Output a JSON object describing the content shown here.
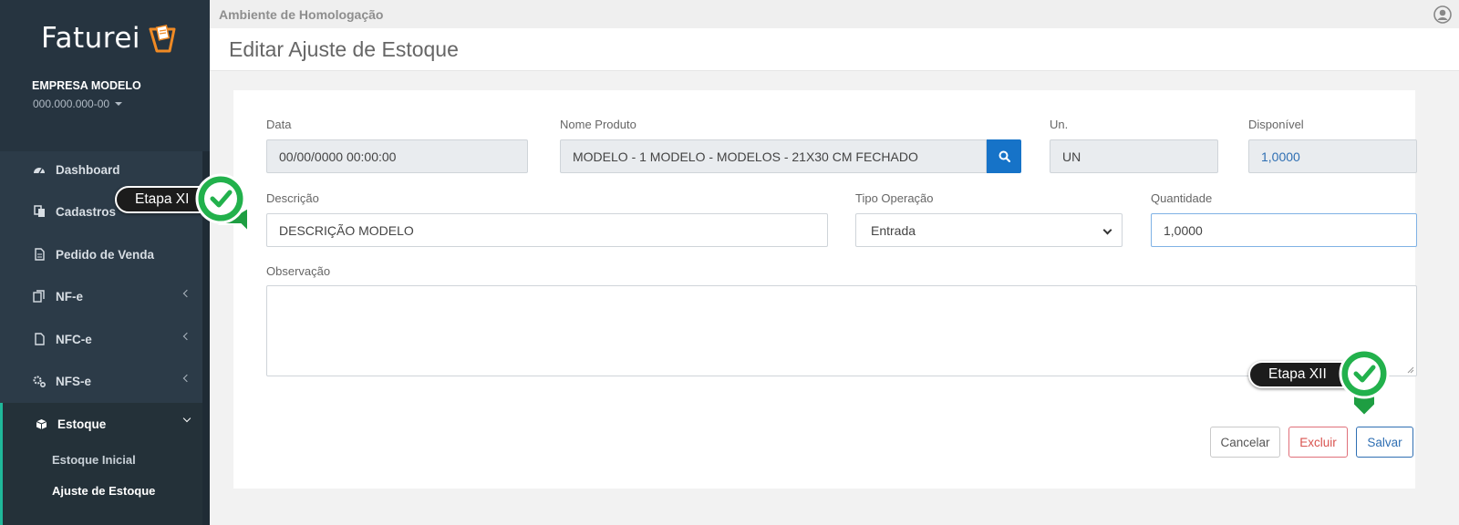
{
  "app": {
    "logo_text": "Faturei",
    "environment": "Ambiente de Homologação",
    "page_title": "Editar Ajuste de Estoque"
  },
  "company": {
    "name": "EMPRESA MODELO",
    "id": "000.000.000-00"
  },
  "sidebar": {
    "items": [
      {
        "label": "Dashboard",
        "icon": "dashboard-icon"
      },
      {
        "label": "Cadastros",
        "icon": "copy-icon"
      },
      {
        "label": "Pedido de Venda",
        "icon": "document-icon"
      },
      {
        "label": "NF-e",
        "icon": "files-icon"
      },
      {
        "label": "NFC-e",
        "icon": "file-icon"
      },
      {
        "label": "NFS-e",
        "icon": "gears-icon"
      },
      {
        "label": "Estoque",
        "icon": "cube-icon"
      }
    ],
    "submenu": [
      {
        "label": "Estoque Inicial"
      },
      {
        "label": "Ajuste de Estoque"
      }
    ]
  },
  "form": {
    "data_label": "Data",
    "data_value": "00/00/0000 00:00:00",
    "produto_label": "Nome Produto",
    "produto_value": "MODELO - 1 MODELO - MODELOS - 21X30 CM FECHADO",
    "un_label": "Un.",
    "un_value": "UN",
    "disponivel_label": "Disponível",
    "disponivel_value": "1,0000",
    "descricao_label": "Descrição",
    "descricao_value": "DESCRIÇÃO MODELO",
    "tipo_label": "Tipo Operação",
    "tipo_value": "Entrada",
    "quantidade_label": "Quantidade",
    "quantidade_value": "1,0000",
    "observacao_label": "Observação"
  },
  "buttons": {
    "cancel": "Cancelar",
    "delete": "Excluir",
    "save": "Salvar"
  },
  "callouts": {
    "step11": "Etapa XI",
    "step12": "Etapa XII"
  },
  "colors": {
    "sidebar_bg": "#2c3b48",
    "accent_green": "#1fb89a",
    "primary_blue": "#1673c8",
    "danger_red": "#d9534f",
    "badge_green": "#22b14c"
  }
}
